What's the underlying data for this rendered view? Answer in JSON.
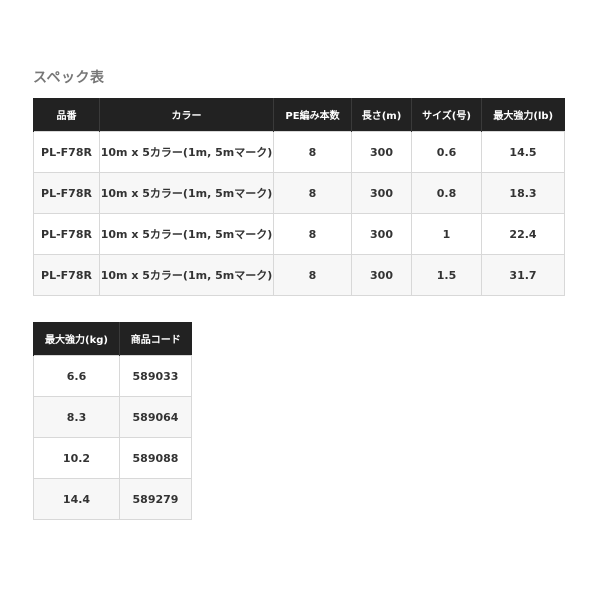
{
  "section_title": "スペック表",
  "table1": {
    "headers": [
      "品番",
      "カラー",
      "PE編み本数",
      "長さ(m)",
      "サイズ(号)",
      "最大強力(lb)"
    ],
    "rows": [
      [
        "PL-F78R",
        "10m x 5カラー(1m, 5mマーク)",
        "8",
        "300",
        "0.6",
        "14.5"
      ],
      [
        "PL-F78R",
        "10m x 5カラー(1m, 5mマーク)",
        "8",
        "300",
        "0.8",
        "18.3"
      ],
      [
        "PL-F78R",
        "10m x 5カラー(1m, 5mマーク)",
        "8",
        "300",
        "1",
        "22.4"
      ],
      [
        "PL-F78R",
        "10m x 5カラー(1m, 5mマーク)",
        "8",
        "300",
        "1.5",
        "31.7"
      ]
    ]
  },
  "table2": {
    "headers": [
      "最大強力(kg)",
      "商品コード"
    ],
    "rows": [
      [
        "6.6",
        "589033"
      ],
      [
        "8.3",
        "589064"
      ],
      [
        "10.2",
        "589088"
      ],
      [
        "14.4",
        "589279"
      ]
    ]
  }
}
